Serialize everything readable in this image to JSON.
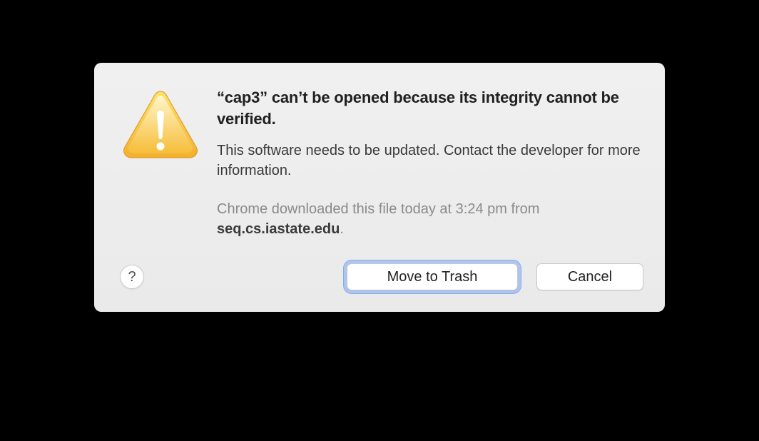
{
  "dialog": {
    "title": "“cap3” can’t be opened because its integrity cannot be verified.",
    "subtitle": "This software needs to be updated. Contact the developer for more information.",
    "source_prefix": "Chrome downloaded this file today at 3:24 pm from ",
    "source_domain": "seq.cs.iastate.edu",
    "source_suffix": ".",
    "buttons": {
      "primary": "Move to Trash",
      "secondary": "Cancel",
      "help": "?"
    }
  }
}
